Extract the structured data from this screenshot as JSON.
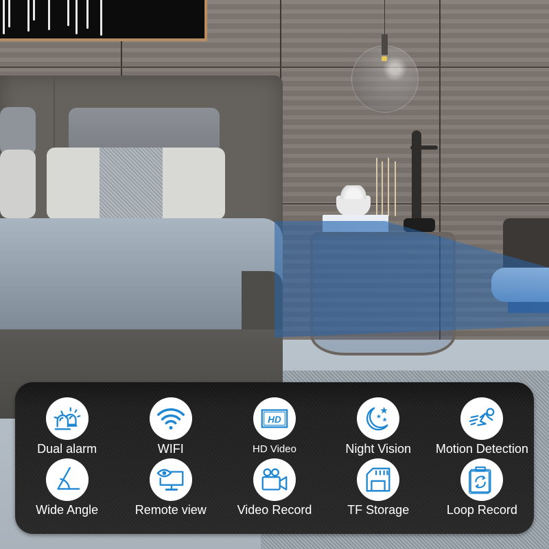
{
  "theme": {
    "icon_color": "#1f87d2",
    "icon_bg": "#ffffff",
    "panel_bg": "#1e1e1e",
    "label_color": "#ffffff",
    "beam_color": "#2864aa"
  },
  "features": [
    {
      "label": "Dual alarm",
      "icon": "dual-alarm-siren-icon"
    },
    {
      "label": "WIFI",
      "icon": "wifi-icon"
    },
    {
      "label": "HD Video",
      "icon": "hd-video-icon"
    },
    {
      "label": "Night Vision",
      "icon": "night-vision-moon-icon"
    },
    {
      "label": "Motion Detection",
      "icon": "motion-detection-runner-icon"
    },
    {
      "label": "Wide Angle",
      "icon": "wide-angle-icon"
    },
    {
      "label": "Remote view",
      "icon": "remote-view-monitor-eye-icon"
    },
    {
      "label": "Video Record",
      "icon": "video-record-camera-icon"
    },
    {
      "label": "TF Storage",
      "icon": "tf-storage-card-icon"
    },
    {
      "label": "Loop Record",
      "icon": "loop-record-clipboard-icon"
    }
  ],
  "icon_text": {
    "hd": "HD"
  }
}
